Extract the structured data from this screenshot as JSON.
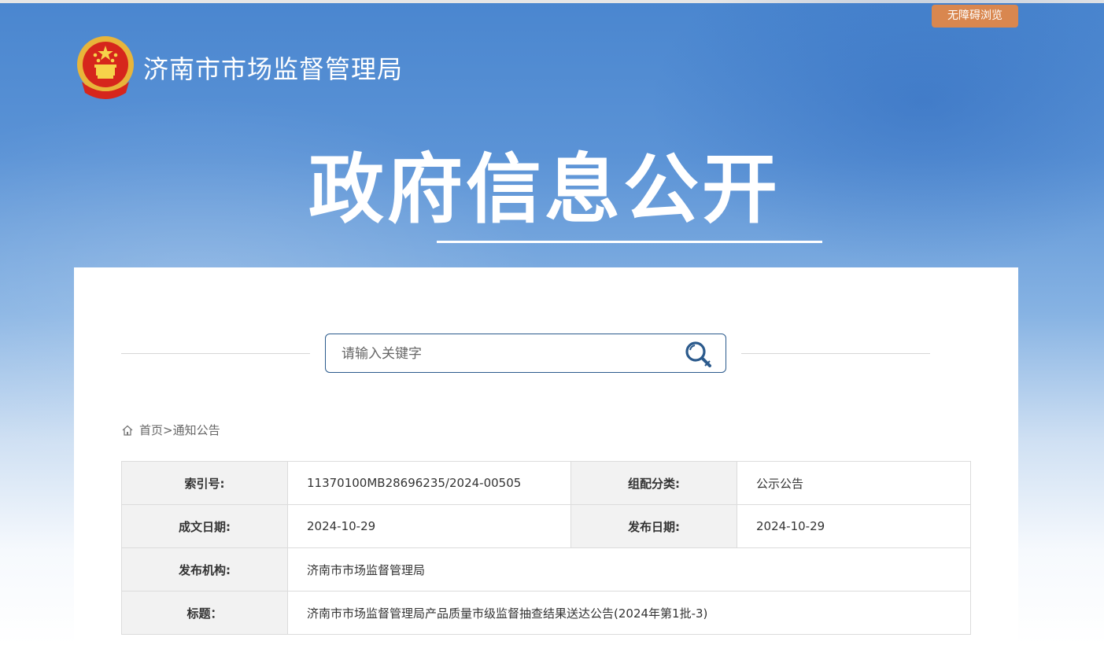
{
  "header": {
    "accessibility_button": "无障碍浏览",
    "site_name": "济南市市场监督管理局",
    "hero_title": "政府信息公开"
  },
  "search": {
    "placeholder": "请输入关键字"
  },
  "breadcrumb": {
    "home": "首页",
    "separator": ">",
    "current": "通知公告"
  },
  "info": {
    "index_label": "索引号:",
    "index_value": "11370100MB28696235/2024-00505",
    "category_label": "组配分类:",
    "category_value": "公示公告",
    "created_label": "成文日期:",
    "created_value": "2024-10-29",
    "published_label": "发布日期:",
    "published_value": "2024-10-29",
    "org_label": "发布机构:",
    "org_value": "济南市市场监督管理局",
    "title_label": "标题：",
    "title_value": "济南市市场监督管理局产品质量市级监督抽查结果送达公告(2024年第1批-3)"
  },
  "colors": {
    "accent_orange": "#d9874f",
    "banner_blue": "#4a86cf",
    "search_border": "#2b5a8c"
  }
}
